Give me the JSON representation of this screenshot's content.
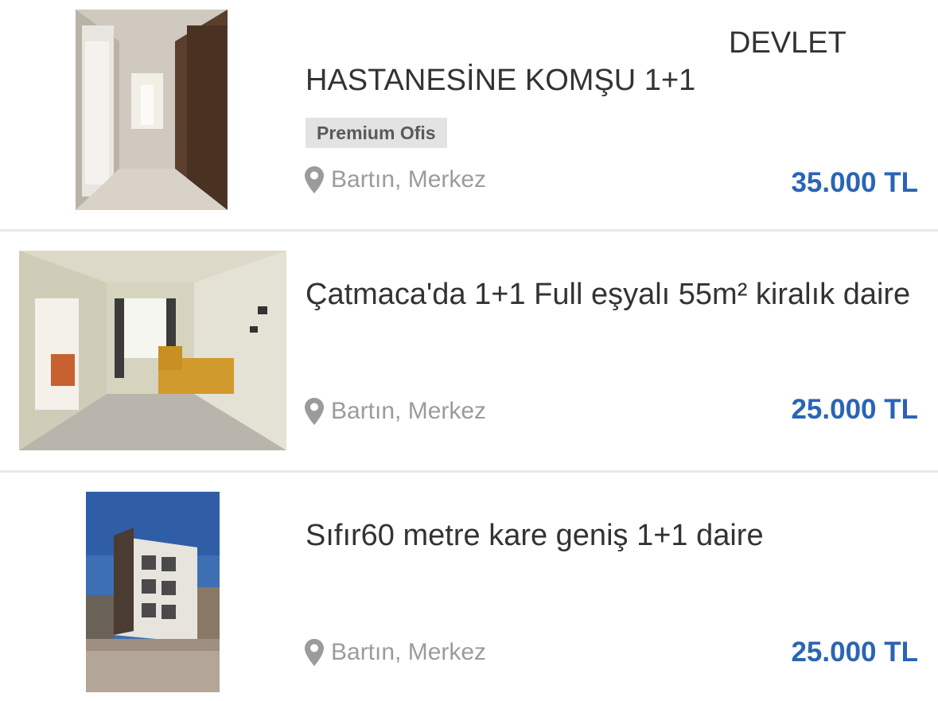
{
  "listings": [
    {
      "title_line1": "DEVLET",
      "title_line2": "HASTANESİNE KOMŞU 1+1",
      "badge": "Premium Ofis",
      "location": "Bartın, Merkez",
      "price": "35.000 TL"
    },
    {
      "title": "Çatmaca'da 1+1 Full eşyalı 55m² kiralık daire",
      "location": "Bartın, Merkez",
      "price": "25.000 TL"
    },
    {
      "title": "Sıfır60 metre kare geniş 1+1 daire",
      "location": "Bartın, Merkez",
      "price": "25.000 TL"
    }
  ],
  "colors": {
    "price": "#2a65b4",
    "location": "#9b9b9b",
    "badge_bg": "#e3e3e3",
    "title": "#333333"
  },
  "icons": {
    "location": "map-pin-icon"
  }
}
